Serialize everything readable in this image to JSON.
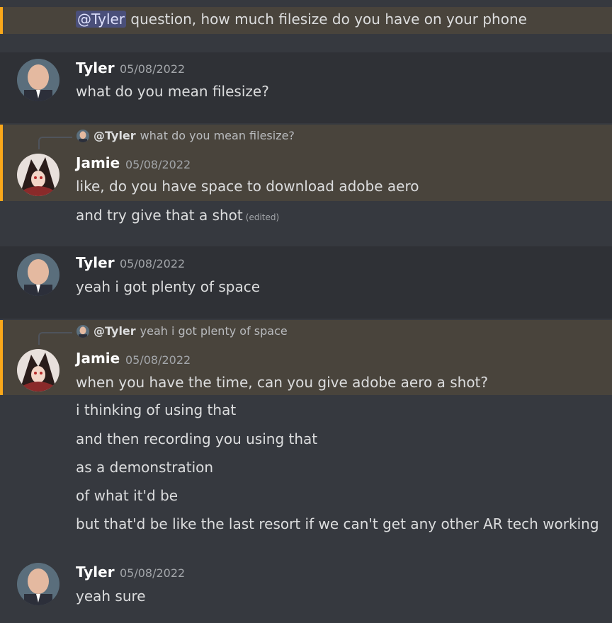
{
  "messages": {
    "m0": {
      "mention": "@Tyler",
      "text": " question, how much filesize do you have on your phone"
    },
    "m1": {
      "author": "Tyler",
      "date": "05/08/2022",
      "text": "what do you mean filesize?"
    },
    "m2": {
      "reply_to": {
        "mention": "@Tyler",
        "text": "what do you mean filesize?"
      },
      "author": "Jamie",
      "date": "05/08/2022",
      "lines": [
        "like, do you have space to download adobe aero",
        "and try give that a shot"
      ],
      "edited": "(edited)"
    },
    "m3": {
      "author": "Tyler",
      "date": "05/08/2022",
      "text": "yeah i got plenty of space"
    },
    "m4": {
      "reply_to": {
        "mention": "@Tyler",
        "text": "yeah i got plenty of space"
      },
      "author": "Jamie",
      "date": "05/08/2022",
      "lines": [
        "when you have the time, can you give adobe aero a shot?",
        "i thinking of using that",
        "and then recording you using that",
        "as a demonstration",
        "of what it'd be",
        "but that'd be like the last resort if we can't get any other AR tech working"
      ]
    },
    "m5": {
      "author": "Tyler",
      "date": "05/08/2022",
      "text": "yeah sure"
    }
  },
  "colors": {
    "background": "#36393f",
    "highlight": "#49443c",
    "highlight_bar": "#faa81a",
    "mention_bg": "#4a4f7a"
  },
  "icons": [
    "tyler-avatar-icon",
    "jamie-avatar-icon"
  ]
}
